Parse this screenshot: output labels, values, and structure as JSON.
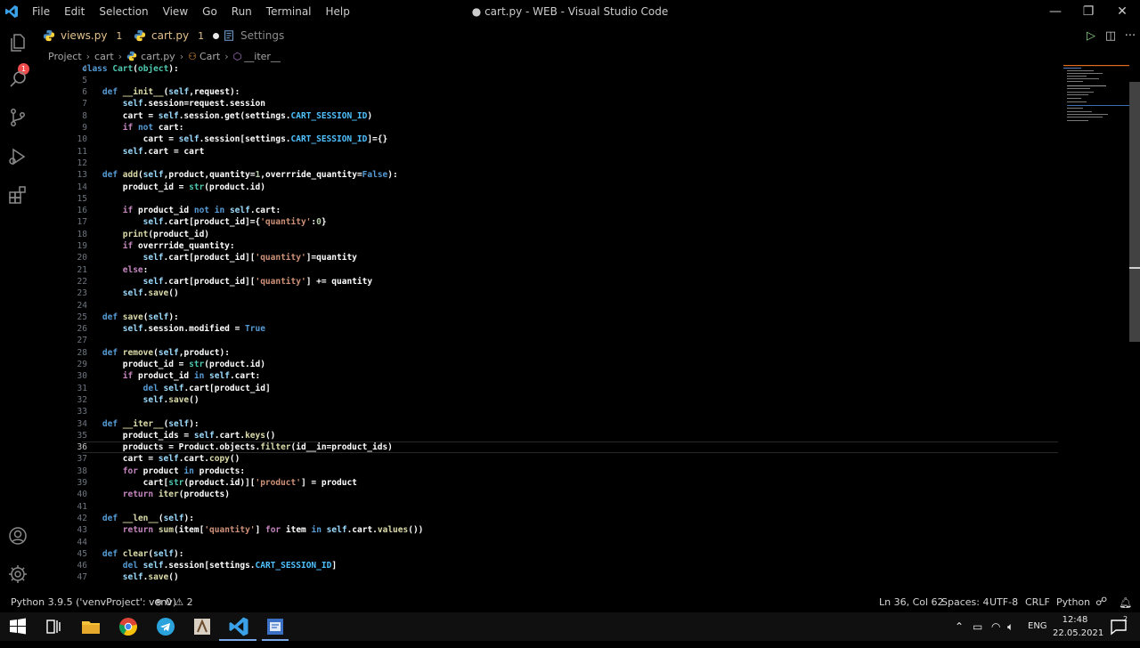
{
  "window": {
    "title": "● cart.py - WEB - Visual Studio Code",
    "menu": [
      "File",
      "Edit",
      "Selection",
      "View",
      "Go",
      "Run",
      "Terminal",
      "Help"
    ],
    "controls": {
      "minimize": "—",
      "restore": "❐",
      "close": "✕"
    }
  },
  "activity_bar": {
    "icons": [
      "explorer-icon",
      "search-icon",
      "source-control-icon",
      "run-debug-icon",
      "extensions-icon",
      "account-icon",
      "settings-gear-icon"
    ],
    "badge": "1"
  },
  "tabs": [
    {
      "label": "views.py",
      "problems": "1",
      "icon": "python-icon"
    },
    {
      "label": "cart.py",
      "problems": "1",
      "icon": "python-icon",
      "dirty": true
    },
    {
      "label": "Settings",
      "icon": "settings-file-icon"
    }
  ],
  "tab_actions": {
    "run": "▷",
    "split": "◫",
    "more": "···"
  },
  "breadcrumb": [
    "Project",
    "cart",
    "cart.py",
    "Cart",
    "__iter__"
  ],
  "editor": {
    "active_line": 36,
    "lines": [
      {
        "n": 4,
        "html": "<span class='kw'>class</span> <span class='cls'>Cart</span>(<span class='cls'>object</span>):"
      },
      {
        "n": 5,
        "html": ""
      },
      {
        "n": 6,
        "html": "    <span class='kw'>def</span> <span class='fn'>__init__</span>(<span class='sf'>self</span>,request):"
      },
      {
        "n": 7,
        "html": "        <span class='sf'>self</span>.session=request.session"
      },
      {
        "n": 8,
        "html": "        cart = <span class='sf'>self</span>.session.get(settings.<span class='con'>CART_SESSION_ID</span>)"
      },
      {
        "n": 9,
        "html": "        <span class='kw2'>if</span> <span class='kw'>not</span> cart:"
      },
      {
        "n": 10,
        "html": "            cart = <span class='sf'>self</span>.session[settings.<span class='con'>CART_SESSION_ID</span>]={}"
      },
      {
        "n": 11,
        "html": "        <span class='sf'>self</span>.cart = cart"
      },
      {
        "n": 12,
        "html": ""
      },
      {
        "n": 13,
        "html": "    <span class='kw'>def</span> <span class='fn'>add</span>(<span class='sf'>self</span>,product,quantity=<span class='num'>1</span>,overrride_quantity=<span class='kw'>False</span>):"
      },
      {
        "n": 14,
        "html": "        product_id = <span class='cls'>str</span>(product.id)"
      },
      {
        "n": 15,
        "html": ""
      },
      {
        "n": 16,
        "html": "        <span class='kw2'>if</span> product_id <span class='kw'>not</span> <span class='kw'>in</span> <span class='sf'>self</span>.cart:"
      },
      {
        "n": 17,
        "html": "            <span class='sf'>self</span>.cart[product_id]={<span class='st'>'quantity'</span>:<span class='num'>0</span>}"
      },
      {
        "n": 18,
        "html": "        <span class='fn'>print</span>(product_id)"
      },
      {
        "n": 19,
        "html": "        <span class='kw2'>if</span> overrride_quantity:"
      },
      {
        "n": 20,
        "html": "            <span class='sf'>self</span>.cart[product_id][<span class='st'>'quantity'</span>]=quantity"
      },
      {
        "n": 21,
        "html": "        <span class='kw2'>else</span>:"
      },
      {
        "n": 22,
        "html": "            <span class='sf'>self</span>.cart[product_id][<span class='st'>'quantity'</span>] += quantity"
      },
      {
        "n": 23,
        "html": "        <span class='sf'>self</span>.<span class='fn'>save</span>()"
      },
      {
        "n": 24,
        "html": ""
      },
      {
        "n": 25,
        "html": "    <span class='kw'>def</span> <span class='fn'>save</span>(<span class='sf'>self</span>):"
      },
      {
        "n": 26,
        "html": "        <span class='sf'>self</span>.session.modified = <span class='kw'>True</span>"
      },
      {
        "n": 27,
        "html": ""
      },
      {
        "n": 28,
        "html": "    <span class='kw'>def</span> <span class='fn'>remove</span>(<span class='sf'>self</span>,product):"
      },
      {
        "n": 29,
        "html": "        product_id = <span class='cls'>str</span>(product.id)"
      },
      {
        "n": 30,
        "html": "        <span class='kw2'>if</span> product_id <span class='kw'>in</span> <span class='sf'>self</span>.cart:"
      },
      {
        "n": 31,
        "html": "            <span class='kw'>del</span> <span class='sf'>self</span>.cart[product_id]"
      },
      {
        "n": 32,
        "html": "            <span class='sf'>self</span>.<span class='fn'>save</span>()"
      },
      {
        "n": 33,
        "html": ""
      },
      {
        "n": 34,
        "html": "    <span class='kw'>def</span> <span class='fn'>__iter__</span>(<span class='sf'>self</span>):"
      },
      {
        "n": 35,
        "html": "        product_ids = <span class='sf'>self</span>.cart.<span class='fn'>keys</span>()"
      },
      {
        "n": 36,
        "html": "        products = Product.objects.<span class='fn'>filter</span>(id__in=product_ids)"
      },
      {
        "n": 37,
        "html": "        cart = <span class='sf'>self</span>.cart.<span class='fn'>copy</span>()"
      },
      {
        "n": 38,
        "html": "        <span class='kw2'>for</span> product <span class='kw'>in</span> products:"
      },
      {
        "n": 39,
        "html": "            cart[<span class='cls'>str</span>(product.id)][<span class='st'>'product'</span>] = product"
      },
      {
        "n": 40,
        "html": "        <span class='kw2'>return</span> <span class='fn'>iter</span>(products)"
      },
      {
        "n": 41,
        "html": ""
      },
      {
        "n": 42,
        "html": "    <span class='kw'>def</span> <span class='fn'>__len__</span>(<span class='sf'>self</span>):"
      },
      {
        "n": 43,
        "html": "        <span class='kw2'>return</span> <span class='fn'>sum</span>(item[<span class='st'>'quantity'</span>] <span class='kw2'>for</span> item <span class='kw'>in</span> <span class='sf'>self</span>.cart.<span class='fn'>values</span>())"
      },
      {
        "n": 44,
        "html": ""
      },
      {
        "n": 45,
        "html": "    <span class='kw'>def</span> <span class='fn'>clear</span>(<span class='sf'>self</span>):"
      },
      {
        "n": 46,
        "html": "        <span class='kw'>del</span> <span class='sf'>self</span>.session[settings.<span class='con'>CART_SESSION_ID</span>]"
      },
      {
        "n": 47,
        "html": "        <span class='sf'>self</span>.<span class='fn'>save</span>()"
      }
    ]
  },
  "status_bar": {
    "interpreter": "Python 3.9.5 ('venvProject': venv)",
    "problems": "⊗ 0 ⚠ 2",
    "cursor": "Ln 36, Col 62",
    "spaces": "Spaces: 4",
    "encoding": "UTF-8",
    "eol": "CRLF",
    "language": "Python"
  },
  "taskbar": {
    "apps": [
      "windows-start-icon",
      "task-view-icon",
      "file-explorer-icon",
      "chrome-icon",
      "telegram-icon",
      "app-icon",
      "vscode-icon",
      "visual-studio-icon"
    ],
    "lang": "ENG",
    "time": "12:48",
    "date": "22.05.2021",
    "notifications": "2"
  },
  "colors": {
    "keyword": "#569cd6",
    "control": "#c586c0",
    "function": "#dcdcaa",
    "class": "#4ec9b0",
    "string": "#ce9178",
    "number": "#b5cea8",
    "constant": "#4fc1ff",
    "modified_tab": "#e2c08d"
  }
}
